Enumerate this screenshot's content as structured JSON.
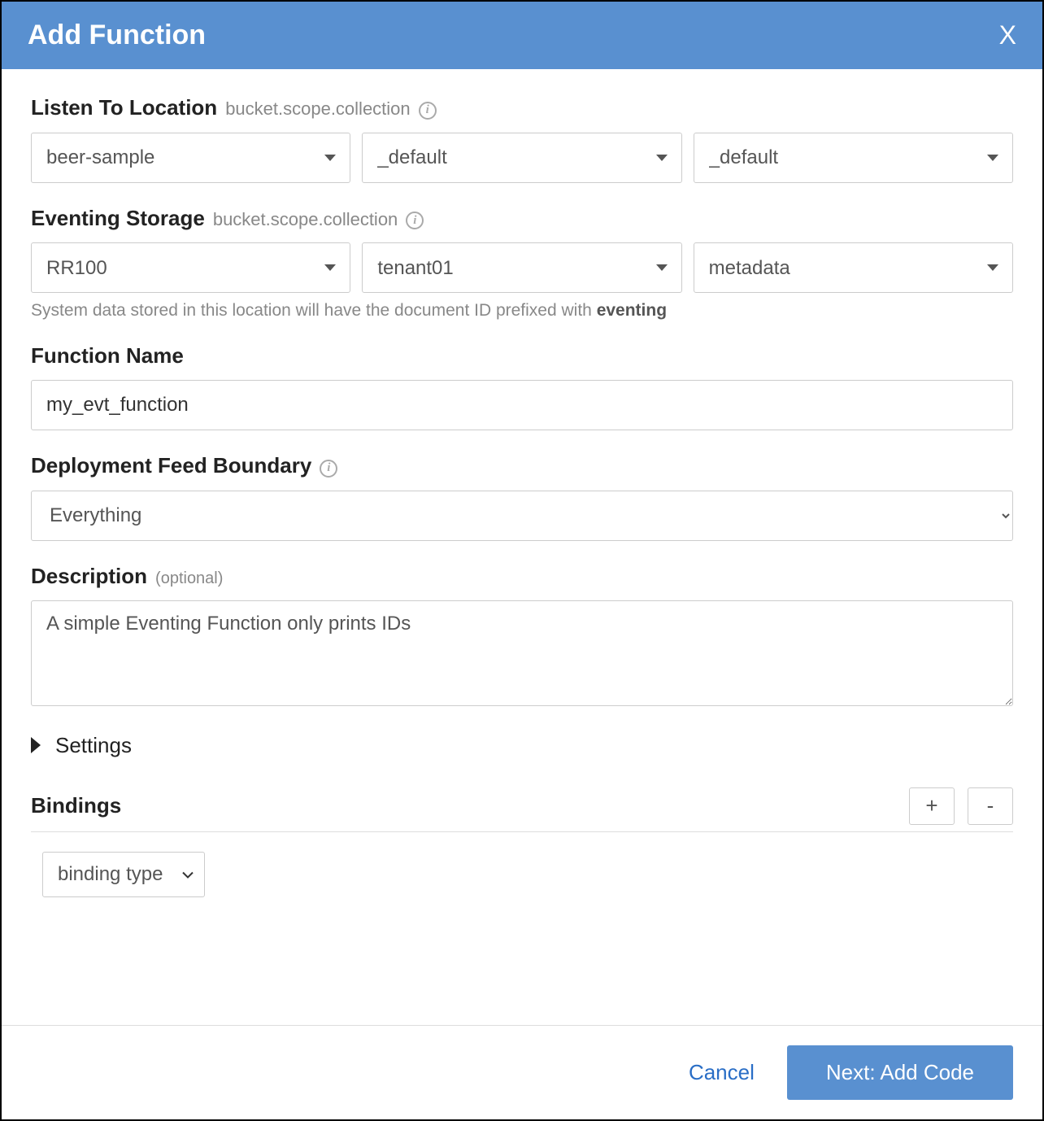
{
  "header": {
    "title": "Add Function",
    "close": "X"
  },
  "listen": {
    "label": "Listen To Location",
    "sublabel": "bucket.scope.collection",
    "bucket": "beer-sample",
    "scope": "_default",
    "collection": "_default"
  },
  "storage": {
    "label": "Eventing Storage",
    "sublabel": "bucket.scope.collection",
    "bucket": "RR100",
    "scope": "tenant01",
    "collection": "metadata",
    "hint_prefix": "System data stored in this location will have the document ID prefixed with ",
    "hint_bold": "eventing"
  },
  "function_name": {
    "label": "Function Name",
    "value": "my_evt_function"
  },
  "boundary": {
    "label": "Deployment Feed Boundary",
    "value": "Everything"
  },
  "description": {
    "label": "Description",
    "optional": "(optional)",
    "value": "A simple Eventing Function only prints IDs"
  },
  "settings": {
    "label": "Settings"
  },
  "bindings": {
    "label": "Bindings",
    "add": "+",
    "remove": "-",
    "type": "binding type"
  },
  "footer": {
    "cancel": "Cancel",
    "next": "Next: Add Code"
  }
}
